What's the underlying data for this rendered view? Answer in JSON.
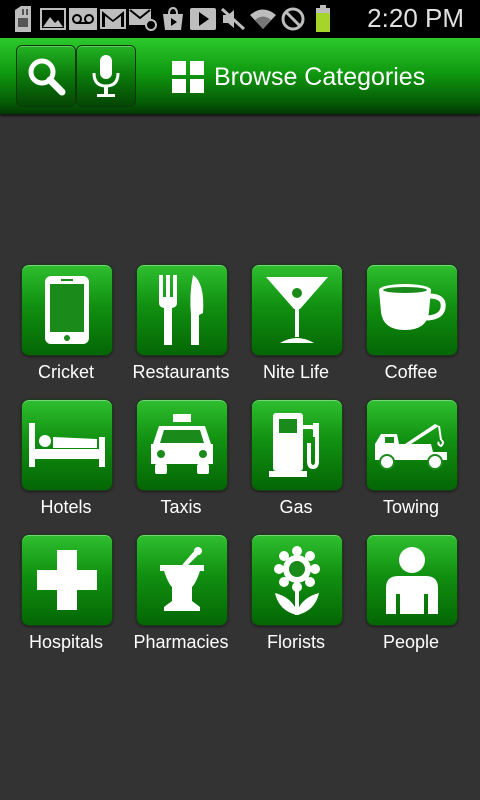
{
  "status_bar": {
    "time": "2:20 PM",
    "icons": [
      "sd-card-icon",
      "image-icon",
      "voicemail-icon",
      "gmail-icon",
      "email-icon",
      "play-store-icon",
      "play-icon",
      "mute-icon",
      "wifi-icon",
      "no-signal-icon",
      "battery-icon"
    ]
  },
  "action_bar": {
    "title": "Browse Categories",
    "search_icon": "search-icon",
    "voice_icon": "microphone-icon",
    "title_icon": "grid-icon"
  },
  "categories": [
    {
      "label": "Cricket",
      "icon": "phone-icon"
    },
    {
      "label": "Restaurants",
      "icon": "fork-knife-icon"
    },
    {
      "label": "Nite Life",
      "icon": "cocktail-icon"
    },
    {
      "label": "Coffee",
      "icon": "coffee-cup-icon"
    },
    {
      "label": "Hotels",
      "icon": "bed-icon"
    },
    {
      "label": "Taxis",
      "icon": "taxi-icon"
    },
    {
      "label": "Gas",
      "icon": "gas-pump-icon"
    },
    {
      "label": "Towing",
      "icon": "tow-truck-icon"
    },
    {
      "label": "Hospitals",
      "icon": "cross-icon"
    },
    {
      "label": "Pharmacies",
      "icon": "mortar-pestle-icon"
    },
    {
      "label": "Florists",
      "icon": "flower-icon"
    },
    {
      "label": "People",
      "icon": "person-icon"
    }
  ],
  "colors": {
    "accent": "#119011",
    "background": "#333333"
  }
}
